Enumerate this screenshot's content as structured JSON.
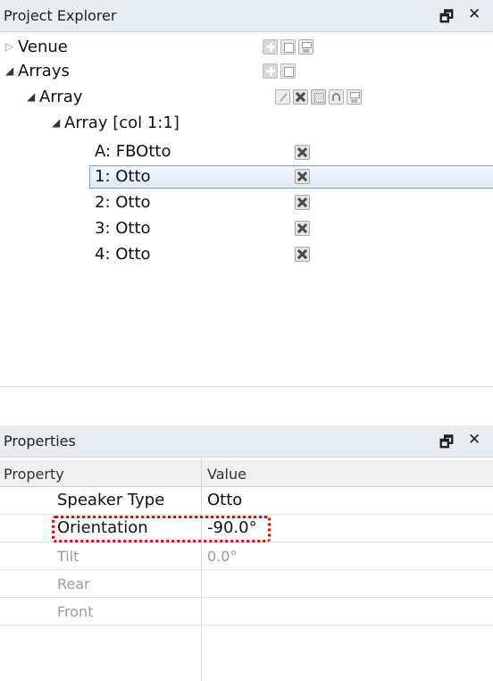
{
  "project_explorer": {
    "title": "Project Explorer",
    "float_glyph": "🗗",
    "close_glyph": "✕",
    "tree": [
      {
        "label": "Venue",
        "expanded": false,
        "icons": [
          "add-icon",
          "document-icon",
          "save-icon"
        ]
      },
      {
        "label": "Arrays",
        "expanded": true,
        "icons": [
          "add-icon",
          "document-icon"
        ]
      },
      {
        "label": "Array",
        "expanded": true,
        "icons": [
          "edit-icon",
          "delete-icon",
          "grid-icon",
          "headphones-icon",
          "save-icon"
        ]
      },
      {
        "label": "Array [col 1:1]",
        "expanded": true,
        "icons": []
      },
      {
        "label": "A: FBOtto",
        "icons": [
          "delete-icon"
        ]
      },
      {
        "label": "1: Otto",
        "selected": true,
        "icons": [
          "delete-icon"
        ]
      },
      {
        "label": "2: Otto",
        "icons": [
          "delete-icon"
        ]
      },
      {
        "label": "3: Otto",
        "icons": [
          "delete-icon"
        ]
      },
      {
        "label": "4: Otto",
        "icons": [
          "delete-icon"
        ]
      }
    ]
  },
  "properties": {
    "title": "Properties",
    "float_glyph": "🗗",
    "close_glyph": "✕",
    "columns": [
      "Property",
      "Value"
    ],
    "rows": [
      {
        "property": "Speaker Type",
        "value": "Otto",
        "enabled": true
      },
      {
        "property": "Orientation",
        "value": "-90.0°",
        "enabled": true,
        "highlighted": true
      },
      {
        "property": "Tilt",
        "value": "0.0°",
        "enabled": false
      },
      {
        "property": "Rear",
        "value": "",
        "enabled": false
      },
      {
        "property": "Front",
        "value": "",
        "enabled": false
      }
    ]
  },
  "colors": {
    "header_bg": "#e8edf1",
    "selection_border": "#7da2ce",
    "highlight_dots": "#d01010",
    "disabled_text": "#9b9b9b"
  }
}
